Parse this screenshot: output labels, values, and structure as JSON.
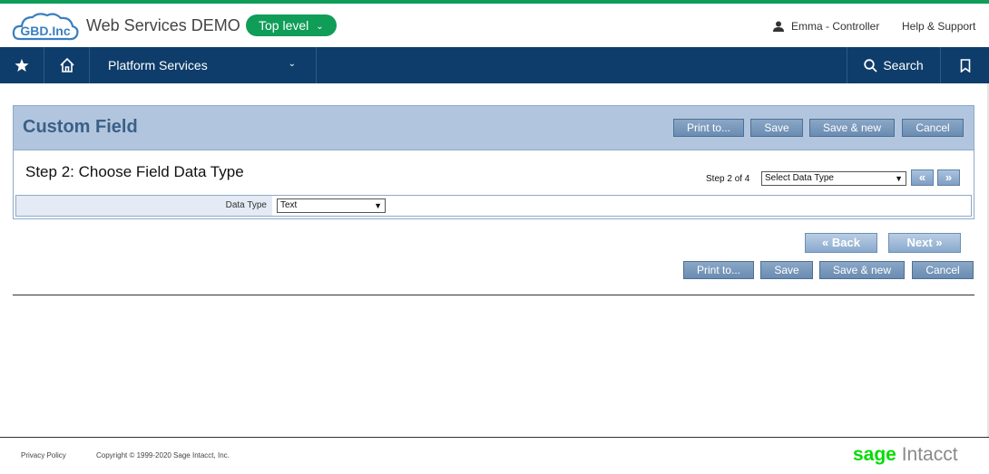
{
  "header": {
    "company_name": "Web Services DEMO",
    "level_label": "Top level",
    "user_label": "Emma - Controller",
    "help_label": "Help & Support",
    "logo_text": "GBD.Inc"
  },
  "nav": {
    "platform_label": "Platform Services",
    "search_label": "Search"
  },
  "page": {
    "title": "Custom Field",
    "toolbar": {
      "print_label": "Print to...",
      "save_label": "Save",
      "save_new_label": "Save & new",
      "cancel_label": "Cancel"
    },
    "step_title": "Step 2: Choose Field Data Type",
    "step_indicator": "Step 2 of 4",
    "step_select_value": "Select Data Type",
    "prev_label": "«",
    "next_arrow_label": "»",
    "data_type_label": "Data Type",
    "data_type_value": "Text",
    "back_label": "« Back",
    "next_label": "Next »"
  },
  "footer": {
    "privacy_label": "Privacy Policy",
    "copyright": "Copyright © 1999-2020 Sage Intacct, Inc.",
    "brand_sage": "sage",
    "brand_intacct": " Intacct"
  },
  "colors": {
    "accent_green": "#0f9d58",
    "nav_blue": "#0e3d6b",
    "panel_blue": "#b1c6de",
    "button_blue": "#6a8cb2"
  }
}
